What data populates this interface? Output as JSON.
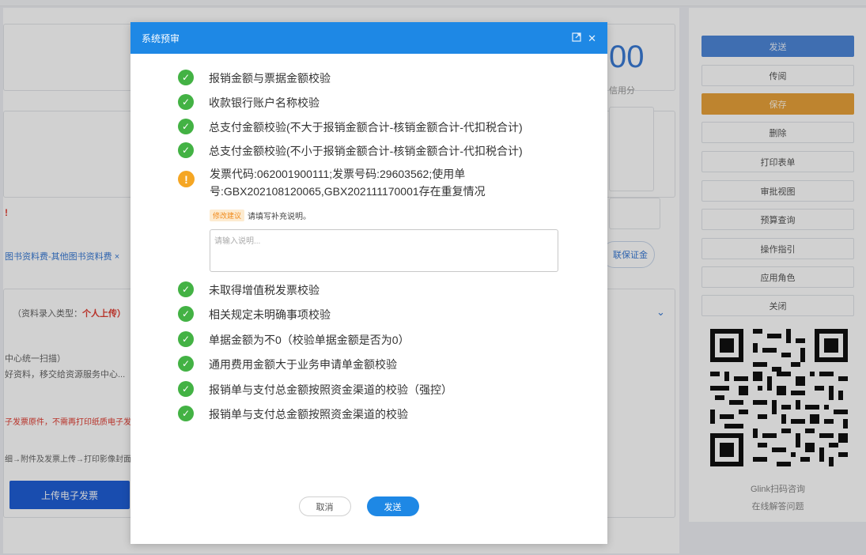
{
  "background": {
    "big_number": "00",
    "big_number_caption": "信用分",
    "breadcrumb_text": "图书资料费-其他图书资料费 ×",
    "pill_button": "联保证金",
    "source_type_label": "（资料录入类型：",
    "source_type_value": "个人上传）",
    "scan_note": "中心统一扫描）",
    "scan_note2": "好资料，移交给资源服务中心...",
    "red_note": "子发票原件，不需再打印纸质电子发...",
    "flow_note": "细→附件及发票上传→打印影像封面",
    "upload_button": "上传电子发票",
    "red_mark": "!"
  },
  "sidebar": {
    "buttons": [
      "发送",
      "传阅",
      "保存",
      "删除",
      "打印表单",
      "审批视图",
      "预算查询",
      "操作指引",
      "应用角色",
      "关闭"
    ],
    "qr_caption1": "Glink扫码咨询",
    "qr_caption2": "在线解答问题"
  },
  "modal": {
    "title": "系统预审",
    "icons": {
      "expand": "expand-icon",
      "close": "close-icon"
    },
    "checks": [
      {
        "status": "ok",
        "text": "报销金额与票据金额校验"
      },
      {
        "status": "ok",
        "text": "收款银行账户名称校验"
      },
      {
        "status": "ok",
        "text": "总支付金额校验(不大于报销金额合计-核销金额合计-代扣税合计)"
      },
      {
        "status": "ok",
        "text": "总支付金额校验(不小于报销金额合计-核销金额合计-代扣税合计)"
      },
      {
        "status": "warn",
        "text": "发票代码:062001900111;发票号码:29603562;使用单号:GBX202108120065,GBX202111170001存在重复情况"
      },
      {
        "status": "ok",
        "text": "未取得增值税发票校验"
      },
      {
        "status": "ok",
        "text": "相关规定未明确事项校验"
      },
      {
        "status": "ok",
        "text": "单据金额为不0（校验单据金额是否为0）"
      },
      {
        "status": "ok",
        "text": "通用费用金额大于业务申请单金额校验"
      },
      {
        "status": "ok",
        "text": "报销单与支付总金额按照资金渠道的校验（强控）"
      },
      {
        "status": "ok",
        "text": "报销单与支付总金额按照资金渠道的校验"
      }
    ],
    "hint_tag": "修改建议",
    "hint_text": "请填写补充说明。",
    "textarea_placeholder": "请输入说明...",
    "cancel_label": "取消",
    "send_label": "发送"
  },
  "colors": {
    "header_blue": "#1e88e5",
    "ok_green": "#43b244",
    "warn_orange": "#f5a623"
  }
}
